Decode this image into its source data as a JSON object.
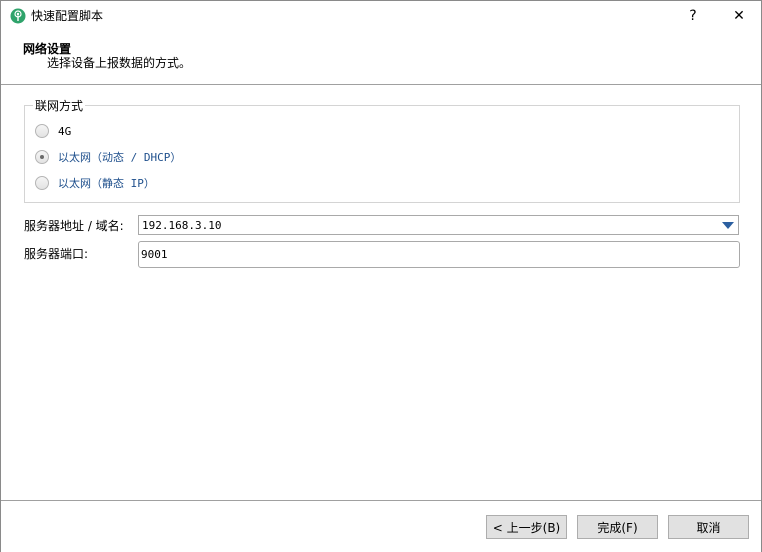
{
  "window": {
    "title": "快速配置脚本",
    "help_label": "?",
    "close_label": "✕",
    "icon": "antenna-icon"
  },
  "header": {
    "title": "网络设置",
    "subtitle": "选择设备上报数据的方式。"
  },
  "network_mode": {
    "legend": "联网方式",
    "options": [
      {
        "label": "4G",
        "checked": false
      },
      {
        "label": "以太网（动态 / DHCP）",
        "checked": true
      },
      {
        "label": "以太网（静态 IP）",
        "checked": false
      }
    ]
  },
  "server": {
    "address_label": "服务器地址 / 域名:",
    "address_value": "192.168.3.10",
    "port_label": "服务器端口:",
    "port_value": "9001"
  },
  "footer": {
    "back_label": "< 上一步(B)",
    "finish_label": "完成(F)",
    "cancel_label": "取消"
  },
  "colors": {
    "accent": "#2b5fa0",
    "option_text": "#1e4f8c"
  }
}
